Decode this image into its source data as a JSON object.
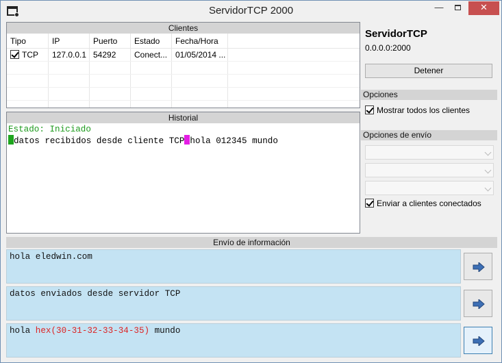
{
  "window": {
    "title": "ServidorTCP 2000",
    "close_glyph": "✕",
    "minimize_glyph": "—"
  },
  "clients": {
    "header": "Clientes",
    "columns": [
      "Tipo",
      "IP",
      "Puerto",
      "Estado",
      "Fecha/Hora"
    ],
    "rows": [
      {
        "tipo": "TCP",
        "ip": "127.0.0.1",
        "puerto": "54292",
        "estado": "Conect...",
        "fecha": "01/05/2014 ..."
      }
    ]
  },
  "historial": {
    "header": "Historial",
    "estado": "Estado: Iniciado",
    "line_left": "datos recibidos desde cliente TCP",
    "line_right": "hola 012345 mundo"
  },
  "server": {
    "title": "ServidorTCP",
    "address": "0.0.0.0:2000",
    "stop_label": "Detener"
  },
  "opciones": {
    "header": "Opciones",
    "show_all_label": "Mostrar todos los clientes"
  },
  "opciones_envio": {
    "header": "Opciones de envío",
    "send_connected_label": "Enviar a clientes conectados"
  },
  "envio": {
    "header": "Envío de información",
    "msg1": "hola eledwin.com",
    "msg2": "datos enviados desde servidor TCP",
    "msg3_pre": "hola ",
    "msg3_hex": "hex(30-31-32-33-34-35)",
    "msg3_post": " mundo"
  },
  "colors": {
    "accent": "#c4e3f3",
    "close": "#c75050",
    "hex_text": "#dd2222",
    "estado_green": "#1c9a1c"
  }
}
